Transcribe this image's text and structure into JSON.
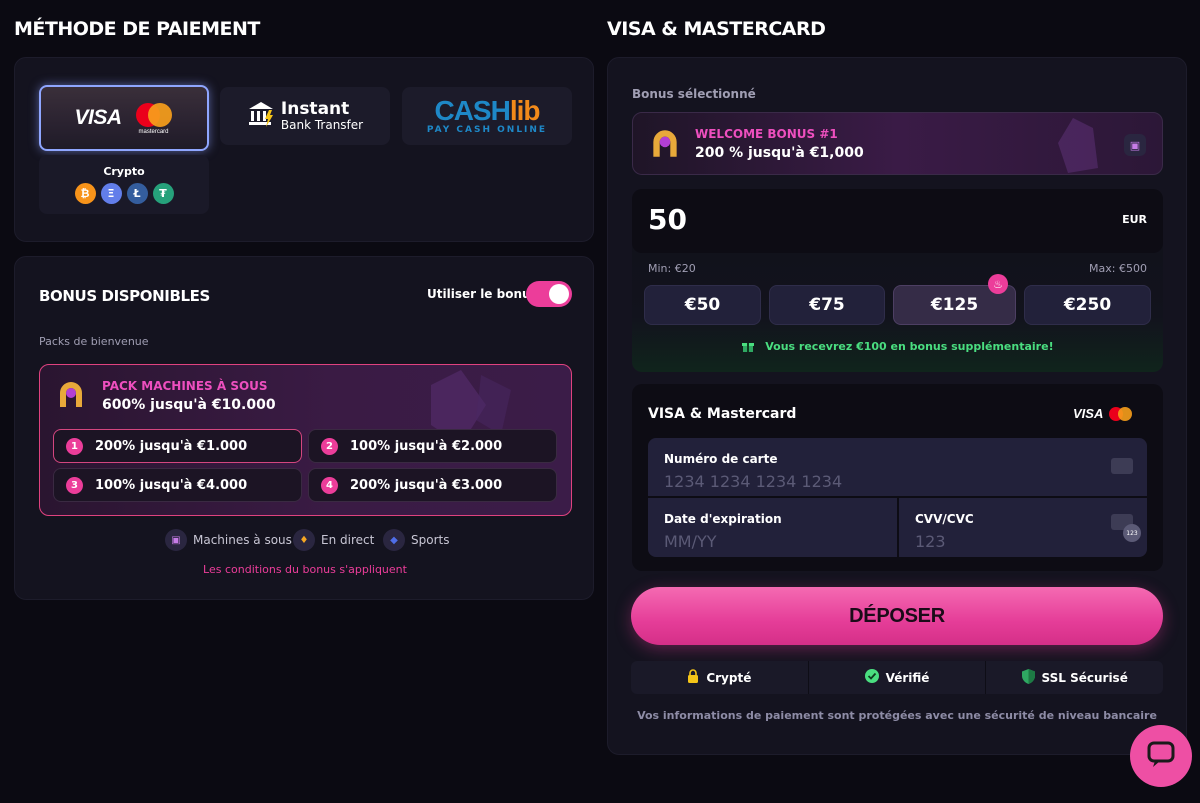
{
  "left": {
    "heading": "MÉTHODE DE PAIEMENT",
    "methods": {
      "visa": {
        "visa_label": "VISA",
        "mc_label": "mastercard"
      },
      "bank": {
        "line1": "Instant",
        "line2": "Bank Transfer"
      },
      "cashlib": {
        "brand_a": "CASH",
        "brand_b": "lib",
        "tagline": "PAY CASH ONLINE"
      },
      "crypto": {
        "label": "Crypto",
        "coins": [
          "₿",
          "Ξ",
          "Ł",
          "₮"
        ]
      }
    },
    "bonus": {
      "title": "BONUS DISPONIBLES",
      "toggle_label": "Utiliser le bonus",
      "subtitle": "Packs de bienvenue",
      "pack_title": "PACK MACHINES À SOUS",
      "pack_desc": "600% jusqu'à €10.000",
      "tiers": [
        {
          "n": "1",
          "text": "200% jusqu'à €1.000"
        },
        {
          "n": "2",
          "text": "100% jusqu'à €2.000"
        },
        {
          "n": "3",
          "text": "100% jusqu'à €4.000"
        },
        {
          "n": "4",
          "text": "200% jusqu'à €3.000"
        }
      ],
      "categories": [
        "Machines à sous",
        "En direct",
        "Sports"
      ],
      "terms": "Les conditions du bonus s'appliquent"
    }
  },
  "right": {
    "heading": "VISA & MASTERCARD",
    "selected_label": "Bonus sélectionné",
    "selected_title": "WELCOME BONUS #1",
    "selected_desc": "200 % jusqu'à €1,000",
    "amount": "50",
    "currency": "EUR",
    "min": "Min: €20",
    "max": "Max: €500",
    "chips": [
      "€50",
      "€75",
      "€125",
      "€250"
    ],
    "bonus_msg": "Vous recevrez €100 en bonus supplémentaire!",
    "card_section_title": "VISA & Mastercard",
    "card_number_label": "Numéro de carte",
    "card_number_ph": "1234 1234 1234 1234",
    "exp_label": "Date d'expiration",
    "exp_ph": "MM/YY",
    "cvv_label": "CVV/CVC",
    "cvv_ph": "123",
    "cvv_badge": "123",
    "deposit": "DÉPOSER",
    "security": [
      "Crypté",
      "Vérifié",
      "SSL Sécurisé"
    ],
    "footer": "Vos informations de paiement sont protégées avec une sécurité de niveau bancaire"
  },
  "colors": {
    "accent": "#ec3d9a",
    "bg": "#0b0a12",
    "panel": "#14131f",
    "green": "#4ade80"
  },
  "icons": [
    "bank-icon",
    "horseshoe-icon",
    "slots-icon",
    "gift-icon",
    "fire-icon",
    "lock-icon",
    "check-icon",
    "shield-icon",
    "chat-icon",
    "card-icon"
  ]
}
